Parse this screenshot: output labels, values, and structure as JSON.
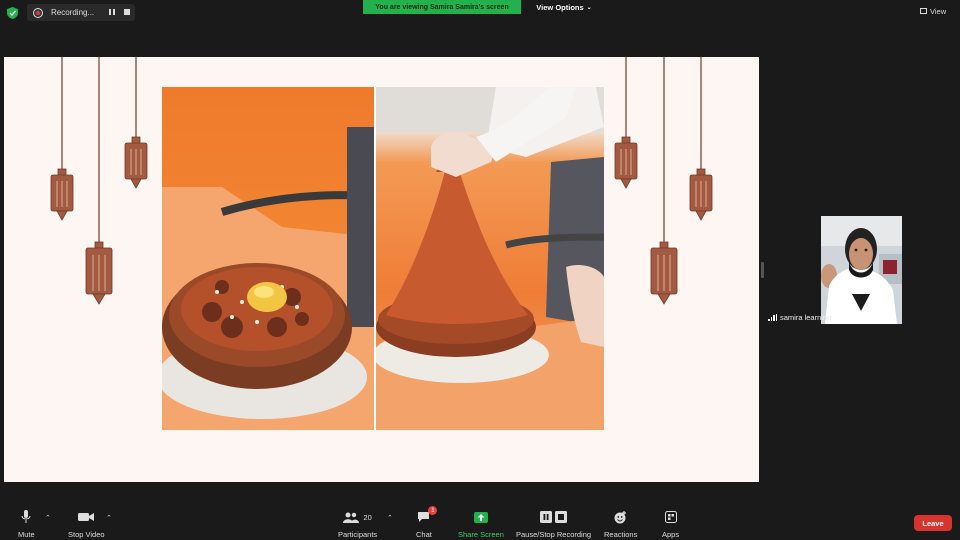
{
  "top_bar": {
    "recording_label": "Recording...",
    "viewing_banner": "You are viewing Samira Samira's screen",
    "view_options_label": "View Options",
    "view_label": "View"
  },
  "participant": {
    "name": "samira learning"
  },
  "toolbar": {
    "mute_label": "Mute",
    "stop_video_label": "Stop Video",
    "participants_label": "Participants",
    "participants_count": "20",
    "chat_label": "Chat",
    "chat_badge": "1",
    "share_screen_label": "Share Screen",
    "pause_stop_recording_label": "Pause/Stop Recording",
    "reactions_label": "Reactions",
    "apps_label": "Apps",
    "leave_label": "Leave"
  },
  "colors": {
    "share_green": "#22b14c",
    "leave_red": "#d8332c",
    "lantern_brown": "#a45a40"
  },
  "icons": [
    "shield-icon",
    "record-icon",
    "pause-icon",
    "stop-icon",
    "view-grid-icon",
    "microphone-icon",
    "video-camera-icon",
    "participants-icon",
    "chat-icon",
    "share-screen-icon",
    "pause-stop-icon",
    "reactions-icon",
    "apps-icon",
    "signal-icon"
  ]
}
